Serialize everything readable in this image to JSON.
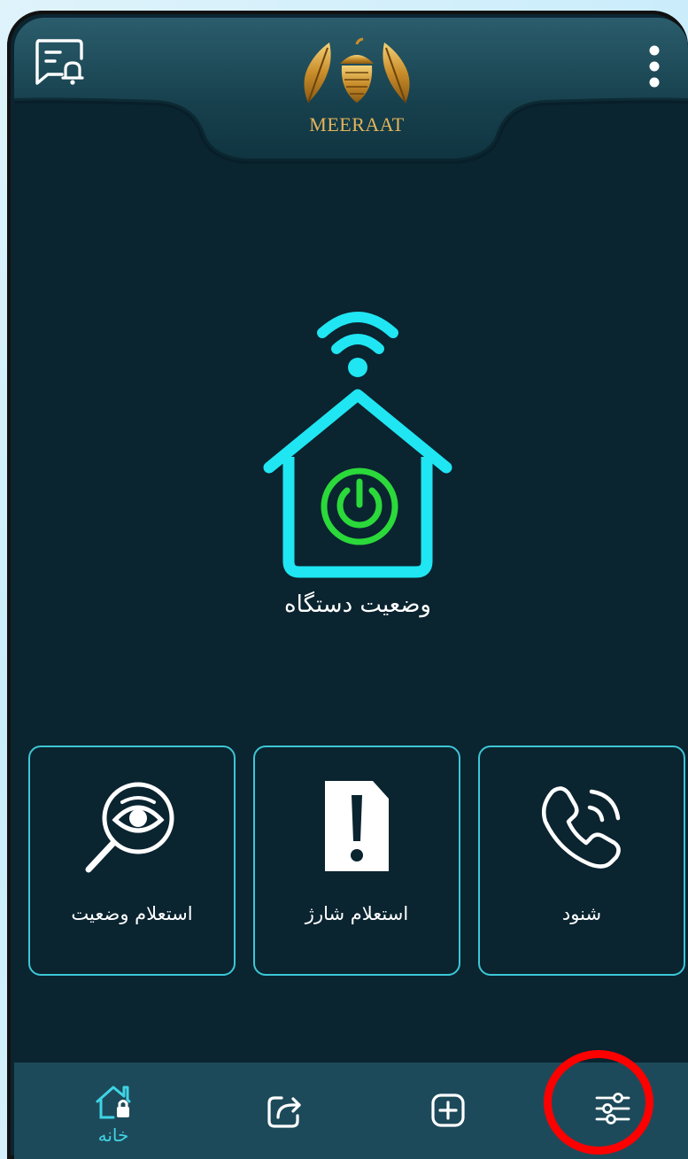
{
  "header": {
    "logo_text": "MEERAAT",
    "notifications_icon": "notification-bell-icon",
    "menu_icon": "more-vertical-icon"
  },
  "device": {
    "status_label": "وضعیت دستگاه",
    "icon": "smart-home-power-icon",
    "power_color": "#2bd93a",
    "accent_color": "#1fe6f2"
  },
  "cards": [
    {
      "label": "استعلام وضعیت",
      "icon": "eye-search-icon"
    },
    {
      "label": "استعلام شارژ",
      "icon": "sim-alert-icon"
    },
    {
      "label": "شنود",
      "icon": "phone-call-icon"
    }
  ],
  "bottom_nav": {
    "items": [
      {
        "label": "خانه",
        "icon": "home-lock-icon",
        "active": true
      },
      {
        "label": "",
        "icon": "share-icon",
        "active": false
      },
      {
        "label": "",
        "icon": "add-box-icon",
        "active": false
      },
      {
        "label": "",
        "icon": "settings-sliders-icon",
        "active": false
      }
    ]
  },
  "colors": {
    "background": "#0a2430",
    "card_border": "#3cc7d6",
    "nav_background": "#1d4a5a",
    "highlight": "#ff0000"
  }
}
